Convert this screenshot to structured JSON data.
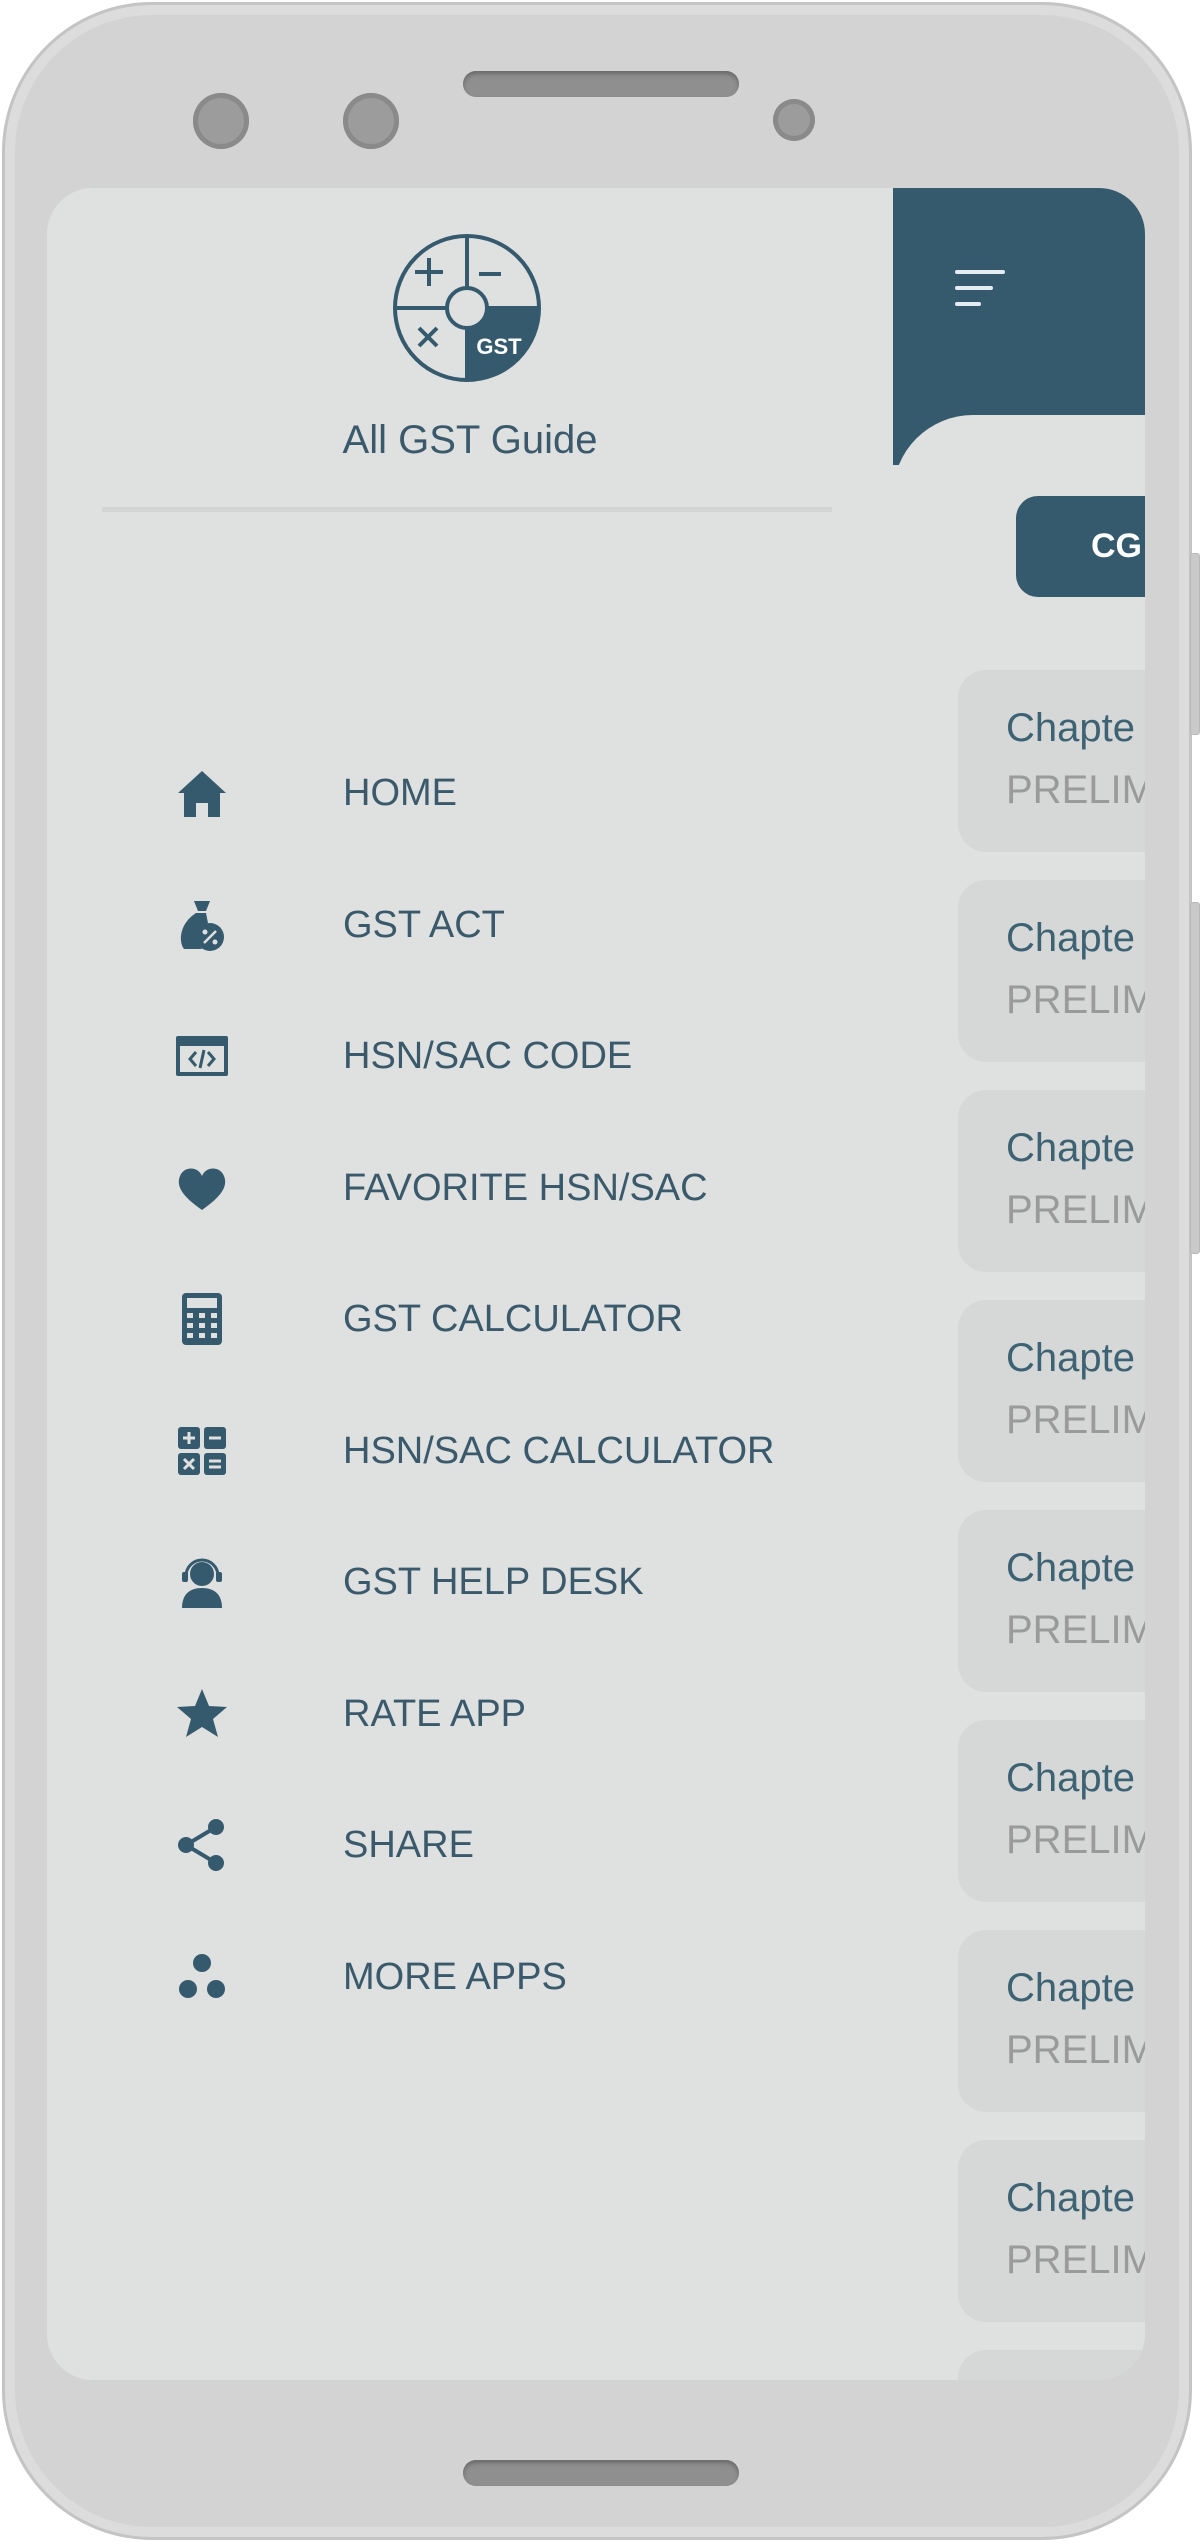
{
  "app": {
    "title": "All GST Guide",
    "logo_text": "GST",
    "accent_color": "#365a6d"
  },
  "drawer": {
    "items": [
      {
        "label": "HOME",
        "icon": "home-icon"
      },
      {
        "label": "GST ACT",
        "icon": "money-bag-percent-icon"
      },
      {
        "label": "HSN/SAC CODE",
        "icon": "code-window-icon"
      },
      {
        "label": "FAVORITE HSN/SAC",
        "icon": "heart-icon"
      },
      {
        "label": "GST CALCULATOR",
        "icon": "calculator-icon"
      },
      {
        "label": "HSN/SAC CALCULATOR",
        "icon": "math-operators-icon"
      },
      {
        "label": "GST HELP DESK",
        "icon": "support-agent-icon"
      },
      {
        "label": "RATE APP",
        "icon": "star-icon"
      },
      {
        "label": "SHARE",
        "icon": "share-icon"
      },
      {
        "label": "MORE APPS",
        "icon": "more-apps-icon"
      }
    ]
  },
  "main": {
    "menu_icon": "menu-icon",
    "tab_button": "CG",
    "cards": [
      {
        "title": "Chapte",
        "subtitle": "PRELIM"
      },
      {
        "title": "Chapte",
        "subtitle": "PRELIM"
      },
      {
        "title": "Chapte",
        "subtitle": "PRELIM"
      },
      {
        "title": "Chapte",
        "subtitle": "PRELIM"
      },
      {
        "title": "Chapte",
        "subtitle": "PRELIM"
      },
      {
        "title": "Chapte",
        "subtitle": "PRELIM"
      },
      {
        "title": "Chapte",
        "subtitle": "PRELIM"
      },
      {
        "title": "Chapte",
        "subtitle": "PRELIM"
      },
      {
        "title": "",
        "subtitle": ""
      }
    ]
  }
}
